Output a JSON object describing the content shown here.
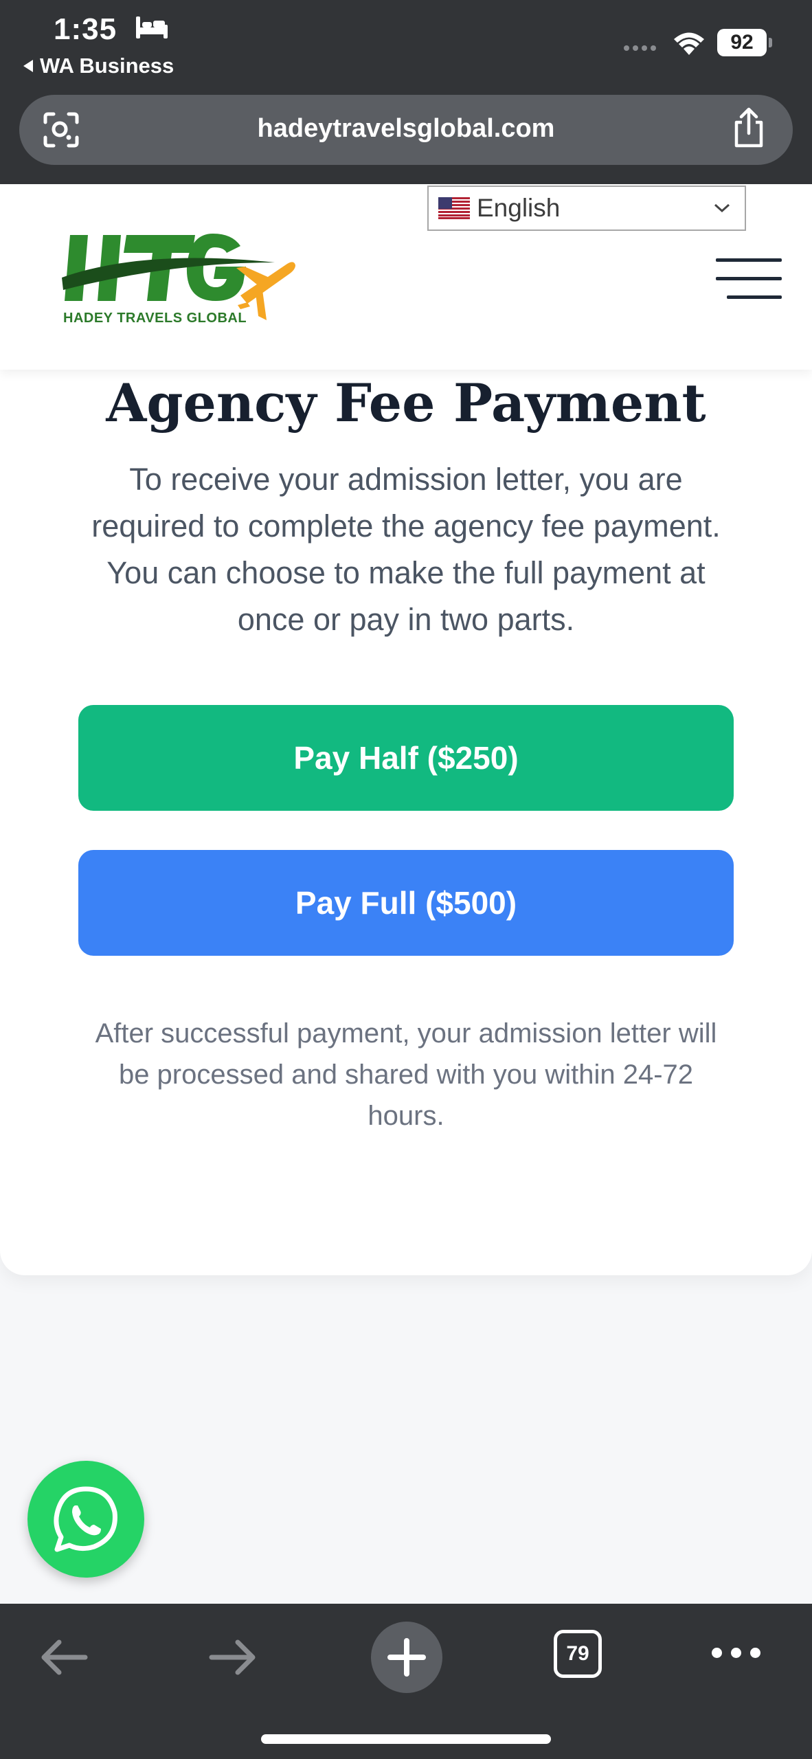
{
  "status_bar": {
    "time": "1:35",
    "back_app": "WA Business",
    "battery": "92"
  },
  "browser": {
    "url": "hadeytravelsglobal.com",
    "tab_count": "79"
  },
  "header": {
    "language": "English",
    "logo_caption": "HADEY TRAVELS GLOBAL"
  },
  "main": {
    "title": "Agency Fee Payment",
    "intro": "To receive your admission letter, you are required to complete the agency fee payment. You can choose to make the full payment at once or pay in two parts.",
    "pay_half_label": "Pay Half ($250)",
    "pay_full_label": "Pay Full ($500)",
    "note": "After successful payment, your admission letter will be processed and shared with you within 24-72 hours."
  },
  "colors": {
    "pay_half": "#12b980",
    "pay_full": "#3b82f6",
    "whatsapp": "#25d366",
    "chrome": "#323437"
  },
  "icons": [
    "bed-icon",
    "wifi-icon",
    "lens-icon",
    "share-icon",
    "us-flag-icon",
    "chevron-down-icon",
    "hamburger-menu-icon",
    "whatsapp-icon",
    "back-arrow-icon",
    "forward-arrow-icon",
    "plus-icon",
    "more-icon"
  ]
}
